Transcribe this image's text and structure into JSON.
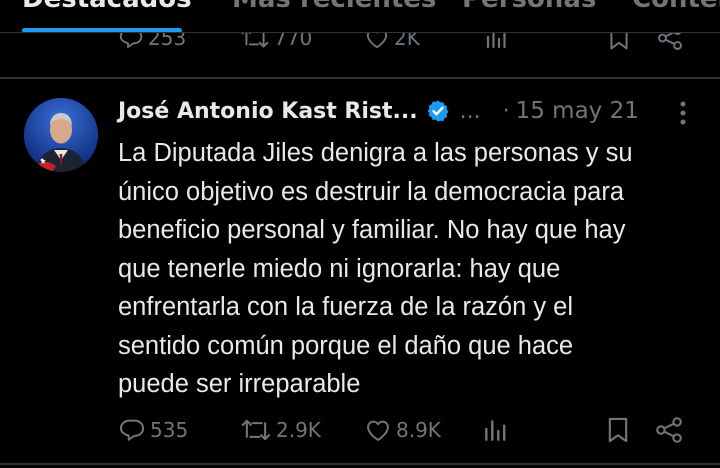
{
  "tabs": [
    {
      "label": "Destacados",
      "active": true
    },
    {
      "label": "Más recientes",
      "active": false
    },
    {
      "label": "Personas",
      "active": false
    },
    {
      "label": "Contenido",
      "active": false
    }
  ],
  "previous_tweet": {
    "replies": "253",
    "reposts": "770",
    "likes": "2K"
  },
  "tweet": {
    "author_name": "José Antonio Kast Rist...",
    "verified": true,
    "handle": "...",
    "separator": "·",
    "date": "15 may 21",
    "text_lines": [
      "La Diputada Jiles denigra a las personas y su",
      "único objetivo es destruir la democracia para",
      "beneficio personal y familiar. No hay que hay",
      "que tenerle miedo ni ignorarla: hay que",
      "enfrentarla con la fuerza de la razón y el",
      "sentido común porque el daño que hace",
      "puede ser irreparable"
    ],
    "stats": {
      "replies": "535",
      "reposts": "2.9K",
      "likes": "8.9K"
    }
  },
  "colors": {
    "background": "#000000",
    "text": "#e7e9ea",
    "muted": "#71767b",
    "accent": "#1d9bf0",
    "border": "#2f3336"
  }
}
